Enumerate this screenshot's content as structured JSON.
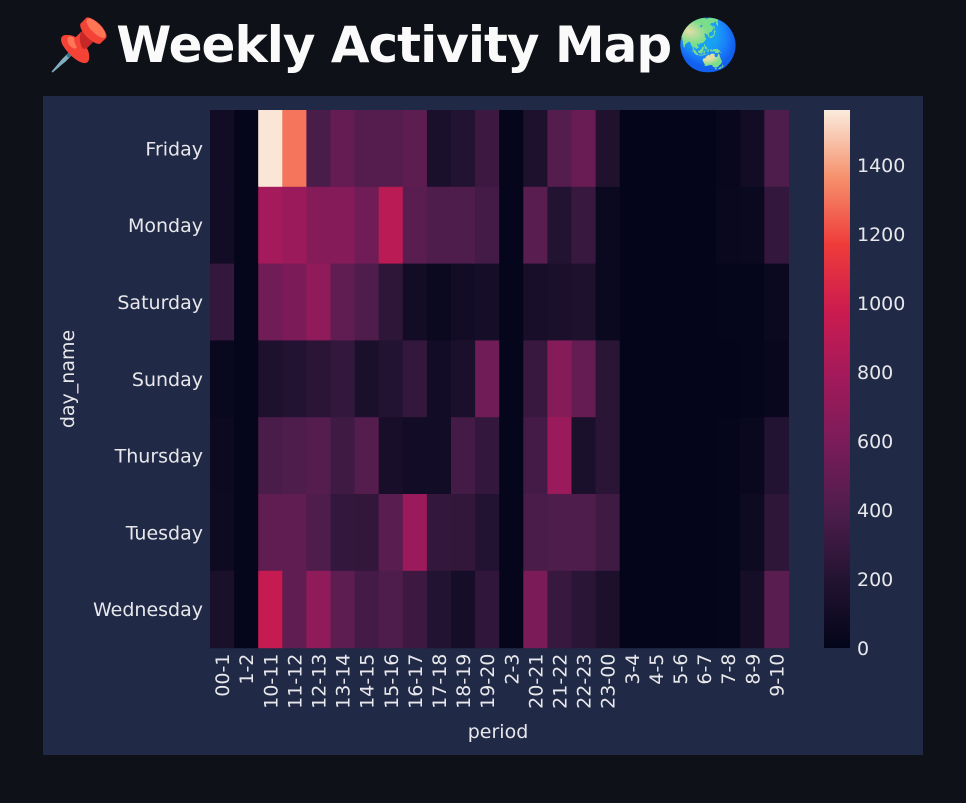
{
  "header": {
    "pin_emoji": "📌",
    "title": "Weekly Activity Map",
    "globe_emoji": "🌏"
  },
  "chart_data": {
    "type": "heatmap",
    "xlabel": "period",
    "ylabel": "day_name",
    "x": [
      "00-1",
      "1-2",
      "10-11",
      "11-12",
      "12-13",
      "13-14",
      "14-15",
      "15-16",
      "16-17",
      "17-18",
      "18-19",
      "19-20",
      "2-3",
      "20-21",
      "21-22",
      "22-23",
      "23-00",
      "3-4",
      "4-5",
      "5-6",
      "6-7",
      "7-8",
      "8-9",
      "9-10"
    ],
    "y": [
      "Friday",
      "Monday",
      "Saturday",
      "Sunday",
      "Thursday",
      "Tuesday",
      "Wednesday"
    ],
    "values": [
      [
        100,
        10,
        1550,
        1300,
        380,
        500,
        430,
        430,
        470,
        150,
        200,
        320,
        10,
        170,
        430,
        520,
        180,
        5,
        5,
        5,
        5,
        30,
        100,
        400
      ],
      [
        100,
        10,
        800,
        750,
        650,
        650,
        550,
        900,
        450,
        400,
        400,
        350,
        10,
        450,
        200,
        300,
        50,
        5,
        5,
        5,
        5,
        40,
        50,
        280
      ],
      [
        280,
        10,
        550,
        600,
        700,
        480,
        400,
        250,
        100,
        50,
        100,
        120,
        10,
        130,
        150,
        170,
        50,
        5,
        5,
        5,
        5,
        10,
        10,
        50
      ],
      [
        40,
        10,
        170,
        200,
        230,
        280,
        150,
        200,
        280,
        100,
        150,
        550,
        10,
        300,
        650,
        500,
        230,
        5,
        5,
        5,
        5,
        5,
        10,
        30
      ],
      [
        60,
        10,
        380,
        400,
        430,
        330,
        430,
        130,
        100,
        100,
        350,
        280,
        10,
        350,
        750,
        150,
        230,
        5,
        5,
        5,
        5,
        10,
        40,
        200
      ],
      [
        70,
        10,
        480,
        480,
        400,
        280,
        270,
        450,
        750,
        280,
        270,
        200,
        10,
        380,
        400,
        400,
        330,
        5,
        5,
        5,
        5,
        10,
        70,
        250
      ],
      [
        150,
        10,
        950,
        480,
        700,
        470,
        350,
        400,
        320,
        200,
        120,
        260,
        10,
        600,
        300,
        230,
        160,
        5,
        5,
        5,
        5,
        10,
        120,
        450
      ]
    ],
    "colorbar": {
      "min": 0,
      "max": 1560,
      "ticks": [
        0,
        200,
        400,
        600,
        800,
        1000,
        1200,
        1400
      ]
    },
    "colormap": "rocket"
  }
}
